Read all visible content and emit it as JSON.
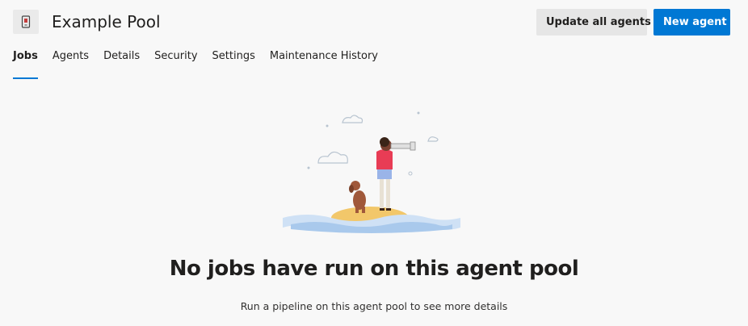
{
  "header": {
    "pool_icon": "agent-pool-icon",
    "title": "Example Pool",
    "update_all_label": "Update all agents",
    "new_agent_label": "New agent"
  },
  "tabs": [
    {
      "label": "Jobs",
      "active": true
    },
    {
      "label": "Agents",
      "active": false
    },
    {
      "label": "Details",
      "active": false
    },
    {
      "label": "Security",
      "active": false
    },
    {
      "label": "Settings",
      "active": false
    },
    {
      "label": "Maintenance History",
      "active": false
    }
  ],
  "empty_state": {
    "illustration": "person-with-telescope-and-dog-on-island",
    "title": "No jobs have run on this agent pool",
    "subtitle": "Run a pipeline on this agent pool to see more details"
  },
  "colors": {
    "accent": "#0078d4",
    "background": "#f8f8f8"
  }
}
